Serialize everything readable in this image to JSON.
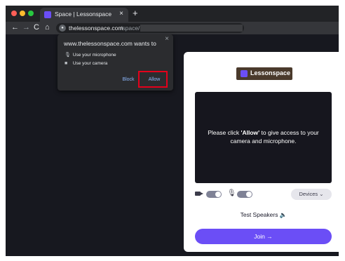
{
  "browser": {
    "tab_title": "Space | Lessonspace",
    "tab_close": "×",
    "new_tab": "+",
    "nav": {
      "back": "←",
      "forward": "→",
      "reload": "C",
      "home": "⌂"
    },
    "url_host": "thelessonspace.com",
    "url_path": "/space/"
  },
  "permission_popup": {
    "title": "www.thelessonspace.com wants to",
    "close": "×",
    "microphone_label": "Use your microphone",
    "camera_label": "Use your camera",
    "block_label": "Block",
    "allow_label": "Allow"
  },
  "card": {
    "logo_text": "Lessonspace",
    "preview_prefix": "Please click ",
    "preview_bold": "'Allow'",
    "preview_suffix": " to give access to your camera and microphone.",
    "devices_label": "Devices ⌄",
    "test_speakers_label": "Test Speakers 🔈",
    "join_label": "Join →"
  },
  "colors": {
    "accent": "#6b4ef6",
    "highlight": "#e4001b",
    "page_bg": "#17181f"
  }
}
